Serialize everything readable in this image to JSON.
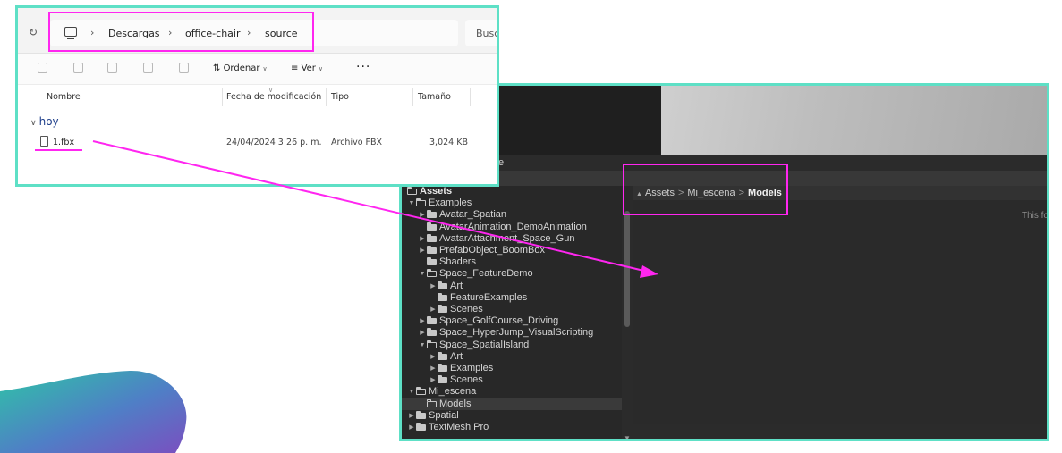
{
  "explorer": {
    "path": [
      "Descargas",
      "office-chair",
      "source"
    ],
    "search_placeholder": "Busc",
    "toolbar": {
      "sort_label": "Ordenar",
      "view_label": "Ver",
      "more_label": "···"
    },
    "columns": [
      "Nombre",
      "Fecha de modificación",
      "Tipo",
      "Tamaño"
    ],
    "group_label": "hoy",
    "files": [
      {
        "name": "1.fbx",
        "modified": "24/04/2024 3:26 p. m.",
        "type": "Archivo FBX",
        "size": "3,024 KB"
      }
    ]
  },
  "unity": {
    "tab_label": "e",
    "breadcrumb": [
      "Assets",
      "Mi_escena",
      "Models"
    ],
    "empty_message": "This fo",
    "tree": [
      {
        "label": "Assets",
        "depth": 0,
        "expanded": true,
        "bold": true,
        "arrow": false
      },
      {
        "label": "Examples",
        "depth": 0,
        "expanded": true,
        "arrow": true
      },
      {
        "label": "Avatar_Spatian",
        "depth": 1,
        "expanded": false,
        "arrow": true
      },
      {
        "label": "AvatarAnimation_DemoAnimation",
        "depth": 1,
        "expanded": false,
        "arrow": false
      },
      {
        "label": "AvatarAttachment_Space_Gun",
        "depth": 1,
        "expanded": false,
        "arrow": true
      },
      {
        "label": "PrefabObject_BoomBox",
        "depth": 1,
        "expanded": false,
        "arrow": true
      },
      {
        "label": "Shaders",
        "depth": 1,
        "expanded": false,
        "arrow": false
      },
      {
        "label": "Space_FeatureDemo",
        "depth": 1,
        "expanded": true,
        "arrow": true
      },
      {
        "label": "Art",
        "depth": 2,
        "expanded": false,
        "arrow": true
      },
      {
        "label": "FeatureExamples",
        "depth": 2,
        "expanded": false,
        "arrow": false
      },
      {
        "label": "Scenes",
        "depth": 2,
        "expanded": false,
        "arrow": true
      },
      {
        "label": "Space_GolfCourse_Driving",
        "depth": 1,
        "expanded": false,
        "arrow": true
      },
      {
        "label": "Space_HyperJump_VisualScripting",
        "depth": 1,
        "expanded": false,
        "arrow": true
      },
      {
        "label": "Space_SpatialIsland",
        "depth": 1,
        "expanded": true,
        "arrow": true
      },
      {
        "label": "Art",
        "depth": 2,
        "expanded": false,
        "arrow": true
      },
      {
        "label": "Examples",
        "depth": 2,
        "expanded": false,
        "arrow": true
      },
      {
        "label": "Scenes",
        "depth": 2,
        "expanded": false,
        "arrow": true
      },
      {
        "label": "Mi_escena",
        "depth": 0,
        "expanded": true,
        "arrow": true
      },
      {
        "label": "Models",
        "depth": 1,
        "expanded": false,
        "arrow": false,
        "selected": true,
        "empty": true
      },
      {
        "label": "Spatial",
        "depth": 0,
        "expanded": false,
        "arrow": true
      },
      {
        "label": "TextMesh Pro",
        "depth": 0,
        "expanded": false,
        "arrow": true
      }
    ]
  },
  "colors": {
    "highlight": "#ff26f0",
    "panel_border": "#5ee0c6",
    "blob_start": "#2ec4a6",
    "blob_end": "#7a4fc0"
  }
}
